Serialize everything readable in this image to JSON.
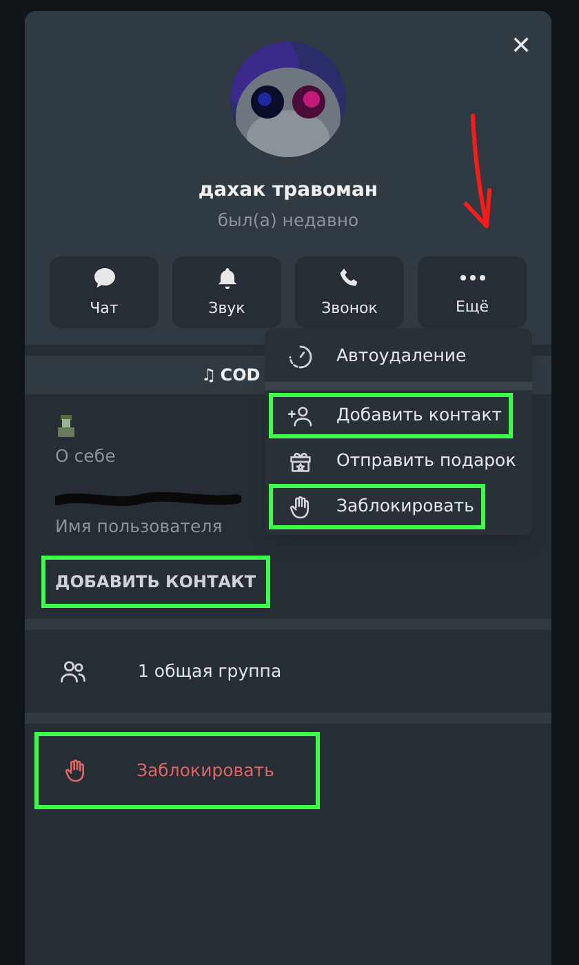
{
  "close_label": "✕",
  "profile": {
    "name": "дахак травоман",
    "status": "был(а) недавно"
  },
  "actions": [
    {
      "label": "Чат",
      "kind": "chat"
    },
    {
      "label": "Звук",
      "kind": "bell"
    },
    {
      "label": "Звонок",
      "kind": "phone"
    },
    {
      "label": "Ещё",
      "kind": "more"
    }
  ],
  "music_bar": {
    "note": "♫",
    "text": "COD"
  },
  "info": {
    "about_label": "О себе",
    "username_label": "Имя пользователя"
  },
  "add_contact_button": {
    "label": "ДОБАВИТЬ КОНТАКТ",
    "highlighted": true
  },
  "groups_row": {
    "text": "1 общая группа"
  },
  "block_row": {
    "label": "Заблокировать",
    "highlighted": true
  },
  "menu": {
    "items": [
      {
        "label": "Автоудаление",
        "kind": "timer",
        "highlighted": false,
        "separator_after": true
      },
      {
        "label": "Добавить контакт",
        "kind": "add-user",
        "highlighted": true,
        "separator_after": false
      },
      {
        "label": "Отправить подарок",
        "kind": "gift",
        "highlighted": false,
        "separator_after": false
      },
      {
        "label": "Заблокировать",
        "kind": "hand",
        "highlighted": true,
        "separator_after": false
      }
    ]
  }
}
